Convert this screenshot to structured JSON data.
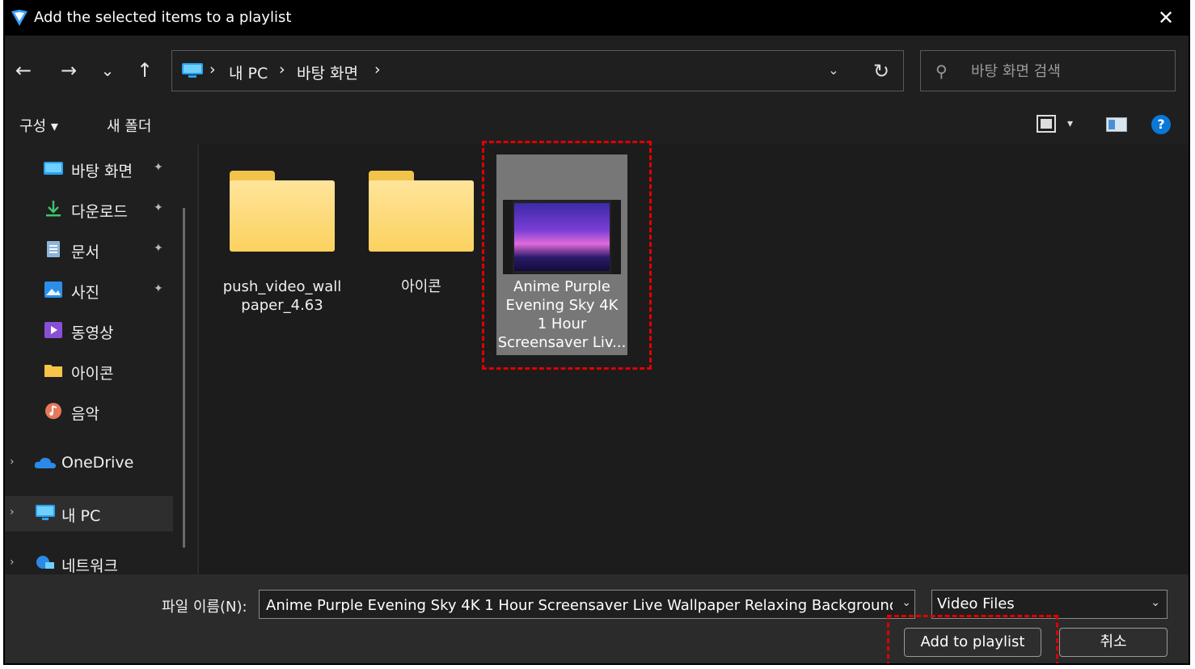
{
  "window": {
    "title": "Add the selected items to a playlist",
    "close_glyph": "✕"
  },
  "nav": {
    "back_glyph": "←",
    "forward_glyph": "→",
    "recent_glyph": "⌄",
    "up_glyph": "↑",
    "breadcrumbs": [
      "내 PC",
      "바탕 화면"
    ],
    "separator": "›",
    "dropdown_glyph": "⌄",
    "refresh_glyph": "↻",
    "search_placeholder": "바탕 화면 검색"
  },
  "toolbar": {
    "organize_label": "구성 ▾",
    "new_folder_label": "새 폴더",
    "view_dropdown_glyph": "▾",
    "help_glyph": "?"
  },
  "sidebar": {
    "quick_access": [
      {
        "label": "바탕 화면",
        "icon": "desktop-icon"
      },
      {
        "label": "다운로드",
        "icon": "download-icon"
      },
      {
        "label": "문서",
        "icon": "documents-icon"
      },
      {
        "label": "사진",
        "icon": "pictures-icon"
      },
      {
        "label": "동영상",
        "icon": "videos-icon"
      },
      {
        "label": "아이콘",
        "icon": "folder-icon"
      },
      {
        "label": "음악",
        "icon": "music-icon"
      }
    ],
    "pin_glyph": "📌",
    "chevron_glyph": "›",
    "onedrive": "OneDrive",
    "this_pc": "내 PC",
    "network": "네트워크"
  },
  "content": {
    "items": [
      {
        "label_line1": "push_video_wall",
        "label_line2": "paper_4.63"
      },
      {
        "label_line1": "아이콘",
        "label_line2": ""
      }
    ],
    "video": {
      "line1": "Anime Purple",
      "line2": "Evening Sky 4K",
      "line3": "1 Hour",
      "line4": "Screensaver Liv..."
    }
  },
  "bottom": {
    "filename_label": "파일 이름(N):",
    "filename_value": "Anime Purple Evening Sky 4K 1 Hour Screensaver Live Wallpaper Relaxing Background Winc",
    "dd_glyph": "⌄",
    "filetype": "Video Files",
    "ok_label": "Add to playlist",
    "cancel_label": "취소"
  },
  "colors": {
    "highlight": "#e00000",
    "accent": "#0a78d7",
    "folder": "#fbd25f"
  }
}
